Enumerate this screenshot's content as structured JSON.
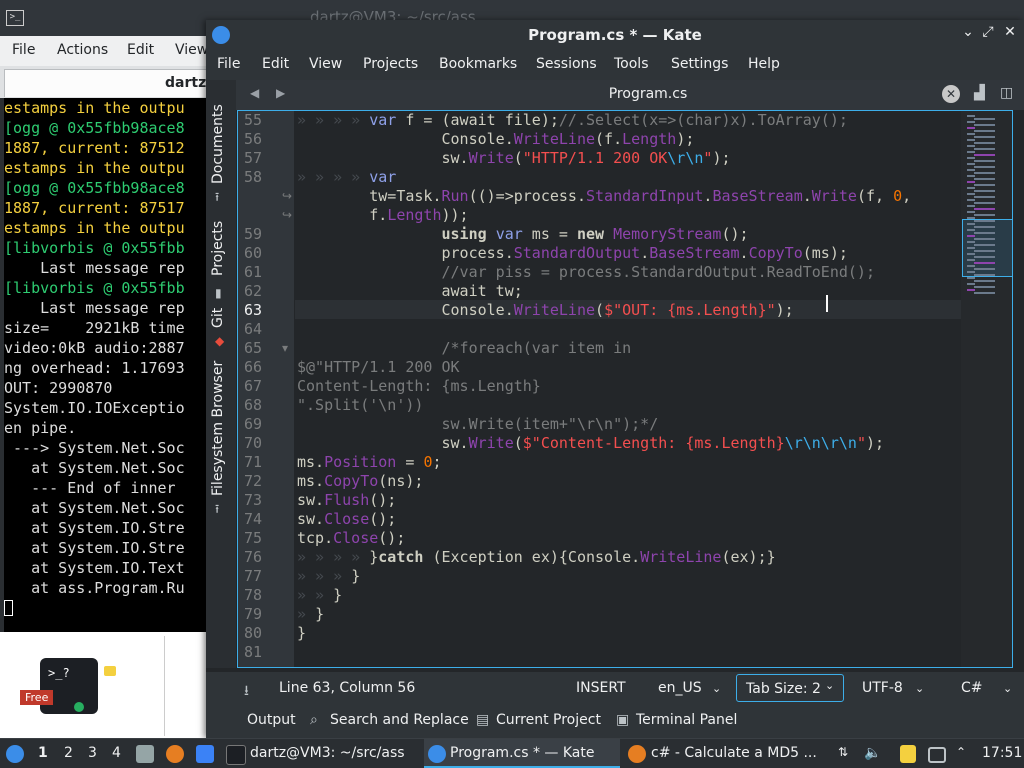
{
  "background": {
    "title_fragment": "dartz@VM3: ~/src/ass",
    "menubar": [
      "File",
      "Actions",
      "Edit",
      "View"
    ],
    "terminal_tab": "dartz",
    "terminal_lines": [
      {
        "text": "estamps in the outpu",
        "color": "#f4d03f"
      },
      {
        "text": "[ogg @ 0x55fbb98ace8",
        "color": "#2ecc71"
      },
      {
        "text": "1887, current: 87512",
        "color": "#f4d03f"
      },
      {
        "text": "estamps in the outpu",
        "color": "#f4d03f"
      },
      {
        "text": "[ogg @ 0x55fbb98ace8",
        "color": "#2ecc71"
      },
      {
        "text": "1887, current: 87517",
        "color": "#f4d03f"
      },
      {
        "text": "estamps in the outpu",
        "color": "#f4d03f"
      },
      {
        "text": "[libvorbis @ 0x55fbb",
        "color": "#2ecc71"
      },
      {
        "text": "    Last message rep",
        "color": "#dddddd"
      },
      {
        "text": "[libvorbis @ 0x55fbb",
        "color": "#2ecc71"
      },
      {
        "text": "    Last message rep",
        "color": "#dddddd"
      },
      {
        "text": "size=    2921kB time",
        "color": "#dddddd"
      },
      {
        "text": "video:0kB audio:2887",
        "color": "#dddddd"
      },
      {
        "text": "ng overhead: 1.17693",
        "color": "#dddddd"
      },
      {
        "text": "OUT: 2990870",
        "color": "#dddddd"
      },
      {
        "text": "System.IO.IOExceptio",
        "color": "#dddddd"
      },
      {
        "text": "en pipe.",
        "color": "#dddddd"
      },
      {
        "text": " ---> System.Net.Soc",
        "color": "#dddddd"
      },
      {
        "text": "   at System.Net.Soc",
        "color": "#dddddd"
      },
      {
        "text": "   --- End of inner ",
        "color": "#dddddd"
      },
      {
        "text": "   at System.Net.Soc",
        "color": "#dddddd"
      },
      {
        "text": "   at System.IO.Stre",
        "color": "#dddddd"
      },
      {
        "text": "   at System.IO.Stre",
        "color": "#dddddd"
      },
      {
        "text": "   at System.IO.Text",
        "color": "#dddddd"
      },
      {
        "text": "   at ass.Program.Ru",
        "color": "#dddddd"
      }
    ],
    "app_badge": "Free",
    "app_prompt": ">_?"
  },
  "kate": {
    "title": "Program.cs * — Kate",
    "menu": [
      "File",
      "Edit",
      "View",
      "Projects",
      "Bookmarks",
      "Sessions",
      "Tools",
      "Settings",
      "Help"
    ],
    "side_tabs": [
      "Documents",
      "Projects",
      "Git",
      "Filesystem Browser"
    ],
    "tab_label": "Program.cs",
    "status": {
      "position": "Line 63, Column 56",
      "mode": "INSERT",
      "lang_dict": "en_US",
      "tab_size": "Tab Size: 2",
      "encoding": "UTF-8",
      "syntax": "C#"
    },
    "bottom_tools": [
      "Output",
      "Search and Replace",
      "Current Project",
      "Terminal Panel"
    ],
    "line_numbers": [
      "55",
      "56",
      "57",
      "58",
      "",
      "",
      "59",
      "60",
      "61",
      "62",
      "63",
      "64",
      "65",
      "66",
      "67",
      "68",
      "69",
      "70",
      "71",
      "72",
      "73",
      "74",
      "75",
      "76",
      "77",
      "78",
      "79",
      "80",
      "81"
    ],
    "current_line": "63"
  },
  "taskbar": {
    "desktops": [
      "1",
      "2",
      "3",
      "4"
    ],
    "terminal_task": "dartz@VM3: ~/src/ass",
    "kate_task": "Program.cs * — Kate",
    "firefox_task": "c# - Calculate a MD5 ...",
    "clock": "17:51"
  },
  "colors": {
    "accent": "#3daee9",
    "editor_bg": "#232629",
    "panel_bg": "#31363b"
  }
}
